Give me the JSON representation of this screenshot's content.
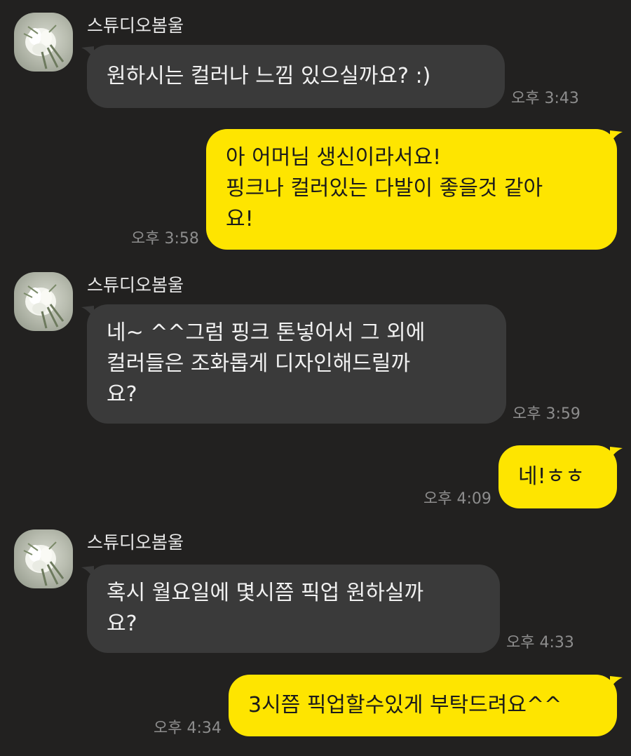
{
  "messages": [
    {
      "sender": "스튜디오봄울",
      "lines": [
        "원하시는 컬러나 느낌 있으실까요? :)"
      ],
      "time": "오후 3:43"
    },
    {
      "lines": [
        "아 어머님 생신이라서요!",
        "핑크나 컬러있는 다발이 좋을것 같아",
        "요!"
      ],
      "time": "오후 3:58"
    },
    {
      "sender": "스튜디오봄울",
      "lines": [
        "네~ ^^그럼 핑크 톤넣어서 그 외에",
        "컬러들은 조화롭게 디자인해드릴까",
        "요?"
      ],
      "time": "오후 3:59"
    },
    {
      "lines": [
        "네!ㅎㅎ"
      ],
      "time": "오후 4:09"
    },
    {
      "sender": "스튜디오봄울",
      "lines": [
        "혹시 월요일에 몇시쯤 픽업 원하실까",
        "요?"
      ],
      "time": "오후 4:33"
    },
    {
      "lines": [
        "3시쯤 픽업할수있게 부탁드려요^^"
      ],
      "time": "오후 4:34"
    }
  ],
  "colors": {
    "background": "#222120",
    "incoming_bubble": "#3a3a3a",
    "outgoing_bubble": "#fee500",
    "timestamp": "#8d8d8d"
  },
  "icons": {
    "avatar": "white-calla-lily-bouquet"
  }
}
